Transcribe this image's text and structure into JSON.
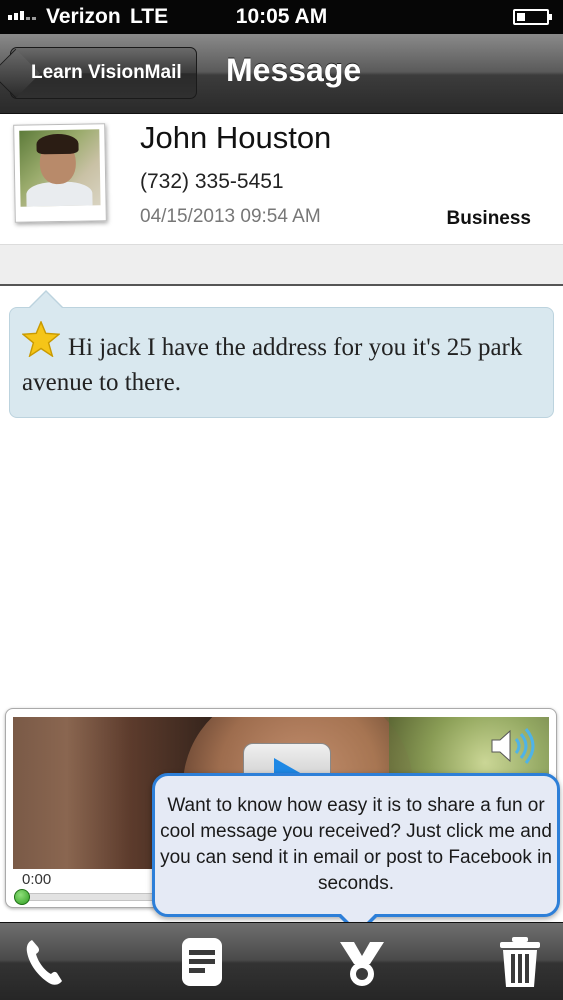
{
  "status_bar": {
    "carrier": "Verizon",
    "network": "LTE",
    "time": "10:05 AM"
  },
  "nav": {
    "back_label": "Learn VisionMail",
    "title": "Message"
  },
  "contact": {
    "name": "John Houston",
    "phone": "(732) 335-5451",
    "datetime": "04/15/2013 09:54 AM",
    "category": "Business"
  },
  "message": {
    "starred": true,
    "transcript": "Hi jack I have the address for you it's 25 park avenue to there."
  },
  "player": {
    "time": "0:00",
    "progress": 0
  },
  "tooltip": {
    "text": "Want to know how easy it is to share a fun or cool message you received? Just click me and you can send it in email or post to Facebook in seconds."
  },
  "toolbar": {
    "icons": [
      "phone-icon",
      "notes-icon",
      "share-icon",
      "trash-icon"
    ]
  },
  "colors": {
    "accent": "#2d7fd8",
    "bubble": "#d9e8ef",
    "star": "#f5c518"
  }
}
